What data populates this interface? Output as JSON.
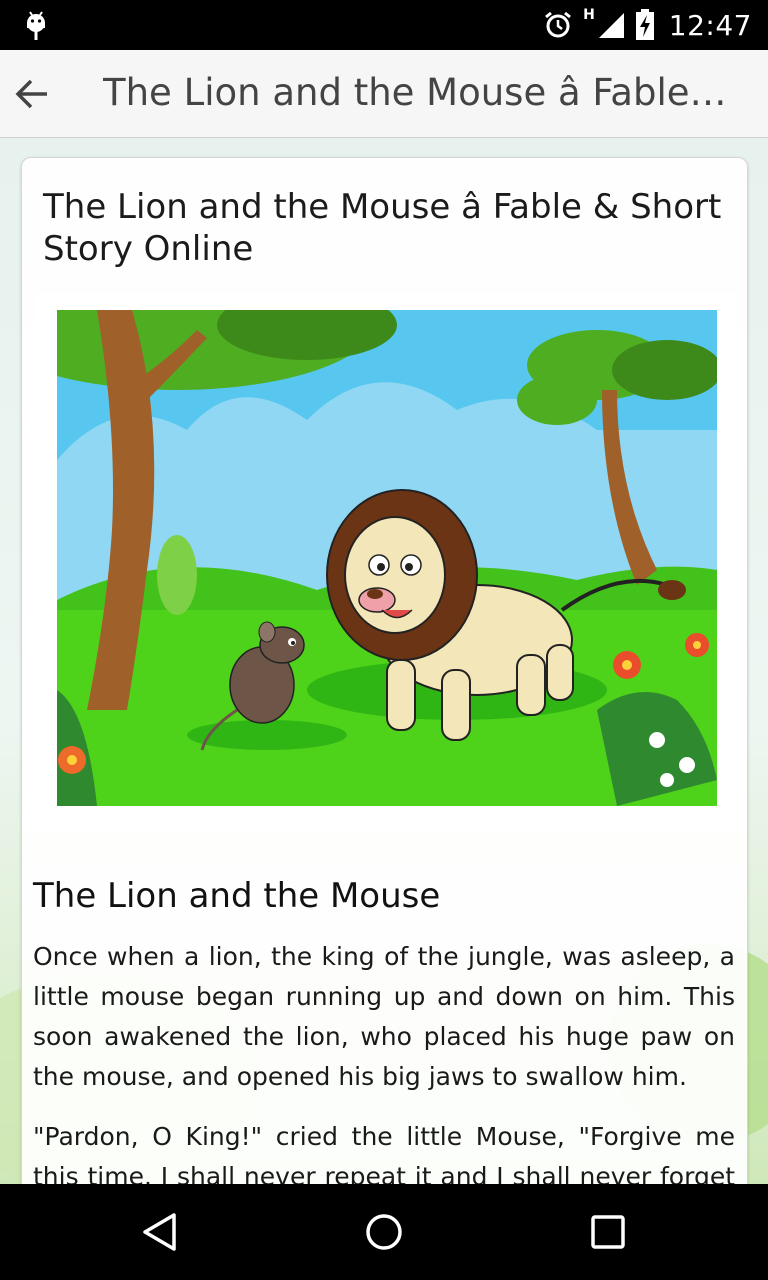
{
  "status_bar": {
    "time": "12:47",
    "network_type": "H",
    "icons": [
      "android-debug-icon",
      "alarm-icon",
      "signal-icon",
      "battery-charging-icon"
    ]
  },
  "app_bar": {
    "title": "The Lion and the Mouse â Fable & Short Story Online",
    "back_icon": "arrow-back-icon"
  },
  "article": {
    "title": "The Lion and the Mouse â Fable & Short Story Online",
    "image_icon": "lion-and-mouse-illustration",
    "heading": "The Lion and the Mouse",
    "paragraphs": [
      "Once when a lion, the king of the jungle, was asleep, a little mouse began running up and down on him. This soon awakened the lion, who placed his huge paw on the mouse, and opened his big jaws to swallow him.",
      "\"Pardon, O King!\" cried the little Mouse, \"Forgive me this time. I shall never repeat it and I shall never forget your kindness."
    ]
  },
  "nav_bar": {
    "back_icon": "nav-back-triangle-icon",
    "home_icon": "nav-home-circle-icon",
    "recents_icon": "nav-recents-square-icon"
  },
  "colors": {
    "sky": "#57c7f0",
    "grass": "#4fd21a",
    "lion_mane": "#6b3515",
    "tree_trunk": "#a0602a"
  }
}
